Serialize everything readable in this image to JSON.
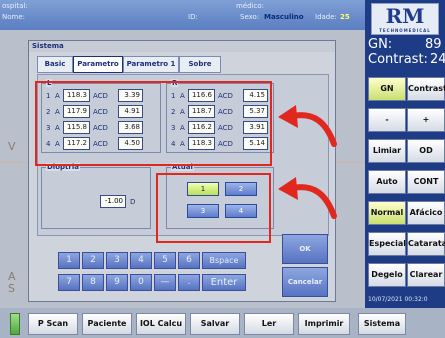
{
  "topbar": {
    "hospital_label": "ospital:",
    "nome_label": "Nome:",
    "id_label": "ID:",
    "medico_label": "médico:",
    "sexo_label": "Sexo:",
    "sexo_value": "Masculino",
    "idade_label": "Idade:",
    "idade_value": "25"
  },
  "ghost": {
    "v": "V",
    "a": "A",
    "s": "S"
  },
  "right_panel": {
    "logo_text": "RM",
    "logo_sub": "TECHNOMEDICAL",
    "gn_label": "GN:",
    "gn_value": "89",
    "contrast_label": "Contrast:",
    "contrast_value": "24",
    "buttons": [
      {
        "label": "GN"
      },
      {
        "label": "Contrast"
      },
      {
        "label": "-"
      },
      {
        "label": "+"
      },
      {
        "label": "Limiar"
      },
      {
        "label": "OD"
      },
      {
        "label": "Auto"
      },
      {
        "label": "CONT"
      },
      {
        "label": "Normal"
      },
      {
        "label": "Afácico"
      },
      {
        "label": "Especial"
      },
      {
        "label": "Catarata"
      },
      {
        "label": "Degelo"
      },
      {
        "label": "Clarear"
      }
    ],
    "datetime": "10/07/2021  00:32:0"
  },
  "dialog": {
    "title": "Sistema",
    "tabs": [
      "Basic",
      "Parametro",
      "Parametro 1",
      "Sobre"
    ],
    "left_group": {
      "label": "L",
      "rows": [
        {
          "n": "1",
          "a": "A",
          "a_val": "118.3",
          "acd": "ACD",
          "acd_val": "3.39"
        },
        {
          "n": "2",
          "a": "A",
          "a_val": "117.9",
          "acd": "ACD",
          "acd_val": "4.91"
        },
        {
          "n": "3",
          "a": "A",
          "a_val": "115.8",
          "acd": "ACD",
          "acd_val": "3.68"
        },
        {
          "n": "4",
          "a": "A",
          "a_val": "117.2",
          "acd": "ACD",
          "acd_val": "4.50"
        }
      ]
    },
    "right_group": {
      "label": "R",
      "rows": [
        {
          "n": "1",
          "a": "A",
          "a_val": "116.6",
          "acd": "ACD",
          "acd_val": "4.15"
        },
        {
          "n": "2",
          "a": "A",
          "a_val": "118.7",
          "acd": "ACD",
          "acd_val": "5.37"
        },
        {
          "n": "3",
          "a": "A",
          "a_val": "116.2",
          "acd": "ACD",
          "acd_val": "3.91"
        },
        {
          "n": "4",
          "a": "A",
          "a_val": "118.3",
          "acd": "ACD",
          "acd_val": "5.14"
        }
      ]
    },
    "dioptria": {
      "label": "Dioptria",
      "value": "-1.00",
      "unit": "D"
    },
    "atual": {
      "label": "Atual",
      "buttons": [
        "1",
        "2",
        "3",
        "4"
      ],
      "selected": "1"
    },
    "keypad": {
      "row1": [
        "1",
        "2",
        "3",
        "4",
        "5",
        "6",
        "Bspace"
      ],
      "row2": [
        "7",
        "8",
        "9",
        "0",
        "—",
        ".",
        "Enter"
      ]
    },
    "ok_label": "OK",
    "cancel_label": "Cancelar"
  },
  "bottom_bar": [
    "P Scan",
    "Paciente",
    "IOL Calcu",
    "Salvar",
    "Ler",
    "Imprimir",
    "Sistema"
  ],
  "colors": {
    "accent": "#1e3c86",
    "highlight": "#e0281e",
    "selected": "#c8e070"
  }
}
